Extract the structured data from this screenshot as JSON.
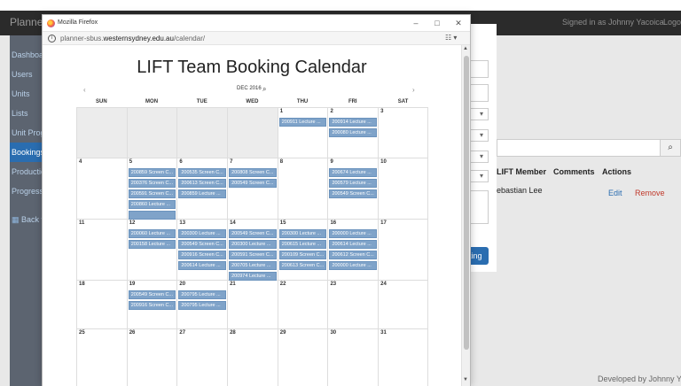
{
  "app": {
    "brand": "Planner",
    "signed_in": "Signed in as Johnny Yacoica",
    "logout": "Logo",
    "footer": "Developed by Johnny Yaco"
  },
  "sidebar": {
    "items": [
      {
        "label": "Dashboard"
      },
      {
        "label": "Users"
      },
      {
        "label": "Units"
      },
      {
        "label": "Lists"
      },
      {
        "label": "Unit Progr"
      },
      {
        "label": "Bookings"
      },
      {
        "label": "Production"
      },
      {
        "label": "Progress"
      },
      {
        "label": "Back to"
      }
    ]
  },
  "panel": {
    "button_label": "king",
    "select_caret": "▾"
  },
  "table": {
    "headers": {
      "member": "LIFT Member",
      "comments": "Comments",
      "actions": "Actions"
    },
    "row": {
      "member": "ebastian Lee",
      "edit": "Edit",
      "remove": "Remove"
    },
    "search_icon": "search-icon"
  },
  "browser": {
    "title": "Mozilla Firefox",
    "url_prefix": "planner-sbus.",
    "url_domain": "westernsydney.edu.au",
    "url_suffix": "/calendar/"
  },
  "calendar": {
    "title": "LIFT Team Booking Calendar",
    "month": "DEC 2016",
    "prev": "‹",
    "next": "›",
    "days": [
      "SUN",
      "MON",
      "TUE",
      "WED",
      "THU",
      "FRI",
      "SAT"
    ],
    "weeks": [
      [
        {
          "day": "",
          "events": []
        },
        {
          "day": "",
          "events": []
        },
        {
          "day": "",
          "events": []
        },
        {
          "day": "",
          "events": []
        },
        {
          "day": "1",
          "events": [
            "200911 Lecture ..."
          ]
        },
        {
          "day": "2",
          "events": [
            "200914 Lecture ...",
            "200080 Lecture ..."
          ]
        },
        {
          "day": "3",
          "events": []
        }
      ],
      [
        {
          "day": "4",
          "events": []
        },
        {
          "day": "5",
          "events": [
            "200859 Screen C...",
            "200376 Screen C...",
            "200591 Screen C...",
            "200860 Lecture ...",
            ""
          ]
        },
        {
          "day": "6",
          "events": [
            "200535 Screen C...",
            "200613 Screen C...",
            "200859 Lecture ..."
          ]
        },
        {
          "day": "7",
          "events": [
            "200808 Screen C...",
            "200549 Screen C..."
          ]
        },
        {
          "day": "8",
          "events": []
        },
        {
          "day": "9",
          "events": [
            "200674 Lecture ...",
            "200579 Lecture ...",
            "200549 Screen C..."
          ]
        },
        {
          "day": "10",
          "events": []
        }
      ],
      [
        {
          "day": "11",
          "events": []
        },
        {
          "day": "12",
          "events": [
            "200060 Lecture ...",
            "200158 Lecture ..."
          ]
        },
        {
          "day": "13",
          "events": [
            "200300 Lecture ...",
            "200549 Screen C...",
            "200916 Screen C...",
            "200614 Lecture ..."
          ]
        },
        {
          "day": "14",
          "events": [
            "200549 Screen C...",
            "200300 Lecture ...",
            "200591 Screen C...",
            "200705 Lecture ...",
            "200974 Lecture ..."
          ]
        },
        {
          "day": "15",
          "events": [
            "200300 Lecture ...",
            "200615 Lecture ...",
            "200109 Screen C...",
            "200613 Screen C..."
          ]
        },
        {
          "day": "16",
          "events": [
            "200000 Lecture ...",
            "200614 Lecture ...",
            "200612 Screen C...",
            "200000 Lecture ..."
          ]
        },
        {
          "day": "17",
          "events": []
        }
      ],
      [
        {
          "day": "18",
          "events": []
        },
        {
          "day": "19",
          "events": [
            "200549 Screen C...",
            "200916 Screen C..."
          ]
        },
        {
          "day": "20",
          "events": [
            "200795 Lecture ...",
            "200795 Lecture ..."
          ]
        },
        {
          "day": "21",
          "events": []
        },
        {
          "day": "22",
          "events": []
        },
        {
          "day": "23",
          "events": []
        },
        {
          "day": "24",
          "events": []
        }
      ],
      [
        {
          "day": "25",
          "events": []
        },
        {
          "day": "26",
          "events": []
        },
        {
          "day": "27",
          "events": []
        },
        {
          "day": "28",
          "events": []
        },
        {
          "day": "29",
          "events": []
        },
        {
          "day": "30",
          "events": []
        },
        {
          "day": "31",
          "events": []
        }
      ]
    ]
  },
  "colors": {
    "navbar": "#2b2b2b",
    "sidebar": "#5c6470",
    "accent": "#2a6db0",
    "event": "#7fa3c9"
  }
}
